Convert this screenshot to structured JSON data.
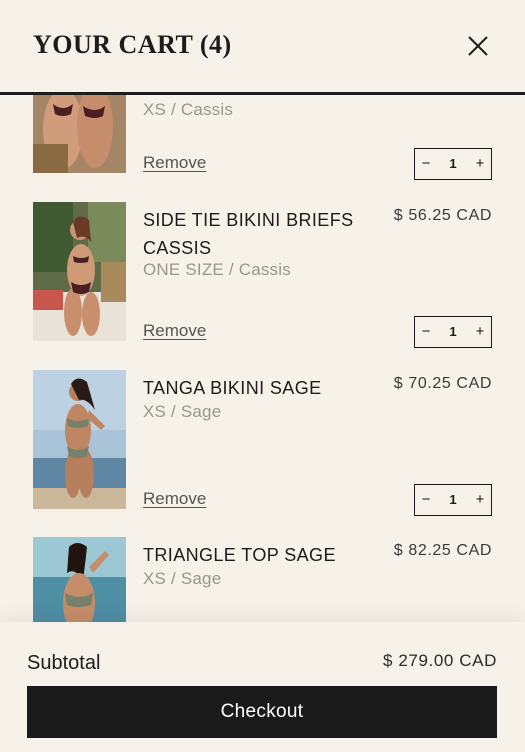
{
  "header": {
    "title": "YOUR CART (4)"
  },
  "items": [
    {
      "name": "",
      "variant": "XS / Cassis",
      "price": "",
      "remove_label": "Remove",
      "quantity": "1"
    },
    {
      "name": "SIDE TIE BIKINI BRIEFS CASSIS",
      "variant": "ONE SIZE / Cassis",
      "price": "$ 56.25 CAD",
      "remove_label": "Remove",
      "quantity": "1"
    },
    {
      "name": "TANGA BIKINI SAGE",
      "variant": "XS / Sage",
      "price": "$ 70.25 CAD",
      "remove_label": "Remove",
      "quantity": "1"
    },
    {
      "name": "TRIANGLE TOP SAGE",
      "variant": "XS / Sage",
      "price": "$ 82.25 CAD",
      "remove_label": "",
      "quantity": ""
    }
  ],
  "footer": {
    "subtotal_label": "Subtotal",
    "subtotal_value": "$ 279.00 CAD",
    "checkout_label": "Checkout"
  },
  "colors": {
    "background": "#f6f2ea",
    "text": "#1c1c1c",
    "muted": "#9a968e",
    "button": "#1a1a1a"
  },
  "icons": {
    "close": "close-icon",
    "minus": "minus-icon",
    "plus": "plus-icon"
  }
}
